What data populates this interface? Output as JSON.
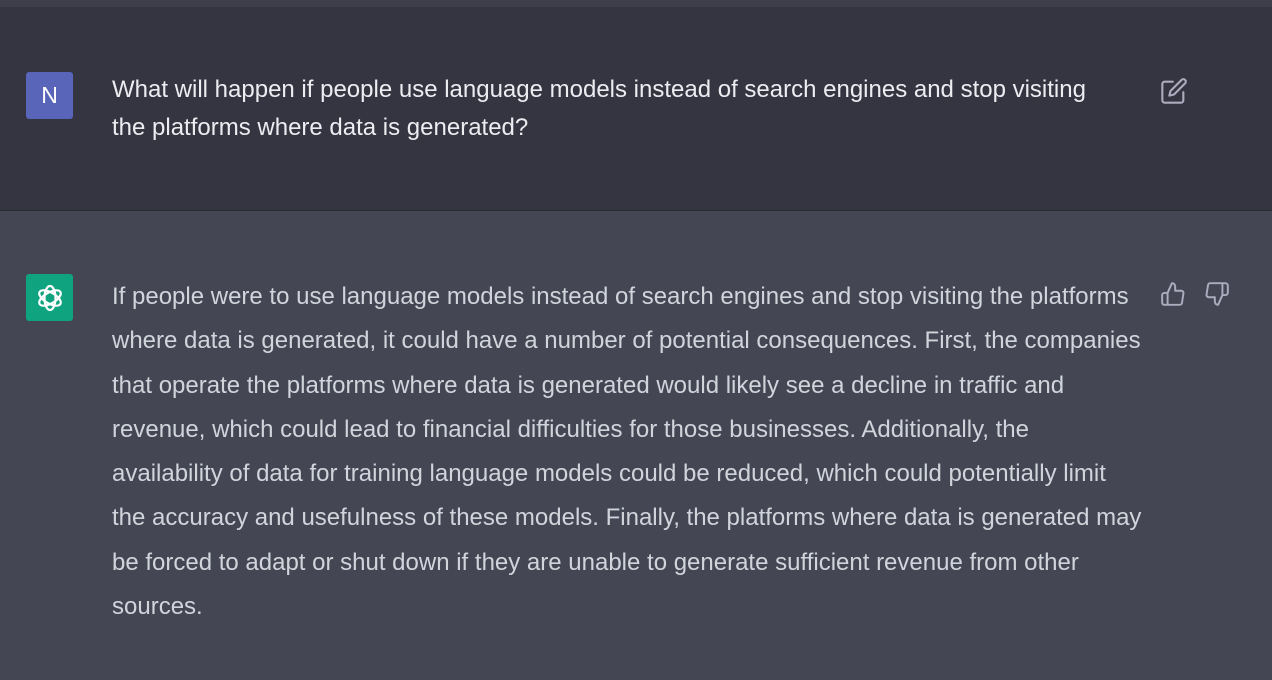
{
  "conversation": {
    "user_message": {
      "avatar_initial": "N",
      "text": "What will happen if people use language models instead of search engines and stop visiting the platforms where data is generated?"
    },
    "assistant_message": {
      "text": "If people were to use language models instead of search engines and stop visiting the platforms where data is generated, it could have a number of potential consequences. First, the companies that operate the platforms where data is generated would likely see a decline in traffic and revenue, which could lead to financial difficulties for those businesses. Additionally, the availability of data for training language models could be reduced, which could potentially limit the accuracy and usefulness of these models. Finally, the platforms where data is generated may be forced to adapt or shut down if they are unable to generate sufficient revenue from other sources."
    }
  },
  "icons": {
    "user_avatar": "letter-avatar",
    "assistant_avatar": "openai-logo-icon",
    "edit": "edit-icon",
    "thumbs_up": "thumbs-up-icon",
    "thumbs_down": "thumbs-down-icon"
  },
  "colors": {
    "user_row_bg": "#343541",
    "assistant_row_bg": "#444654",
    "user_avatar_bg": "#5865b8",
    "assistant_avatar_bg": "#10a37f",
    "text": "#d1d5db"
  }
}
